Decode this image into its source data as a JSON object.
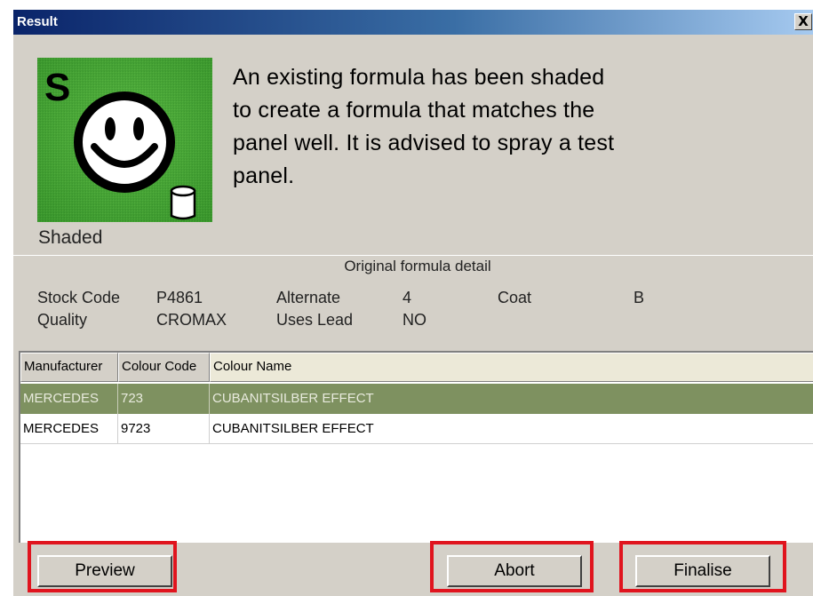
{
  "window": {
    "title": "Result",
    "close_glyph": "X"
  },
  "status": {
    "icon": "smiley-shaded-icon",
    "icon_letter": "S",
    "label": "Shaded",
    "message": "An existing formula has been shaded to create a formula that matches the panel well. It is advised to spray a test panel."
  },
  "detail": {
    "heading": "Original formula detail",
    "stock_code_label": "Stock Code",
    "stock_code_value": "P4861",
    "alternate_label": "Alternate",
    "alternate_value": "4",
    "coat_label": "Coat",
    "coat_value": "B",
    "quality_label": "Quality",
    "quality_value": "CROMAX",
    "uses_lead_label": "Uses Lead",
    "uses_lead_value": "NO"
  },
  "table": {
    "columns": [
      "Manufacturer",
      "Colour Code",
      "Colour Name"
    ],
    "rows": [
      {
        "manufacturer": "MERCEDES",
        "colour_code": "723",
        "colour_name": "CUBANITSILBER EFFECT",
        "selected": true
      },
      {
        "manufacturer": "MERCEDES",
        "colour_code": "9723",
        "colour_name": "CUBANITSILBER EFFECT",
        "selected": false
      }
    ]
  },
  "buttons": {
    "preview": "Preview",
    "abort": "Abort",
    "finalise": "Finalise"
  },
  "colors": {
    "titlebar": "#0a246a",
    "selected_row": "#7e9160",
    "highlight": "#e0141e",
    "icon_background": "#3d9b2c"
  }
}
